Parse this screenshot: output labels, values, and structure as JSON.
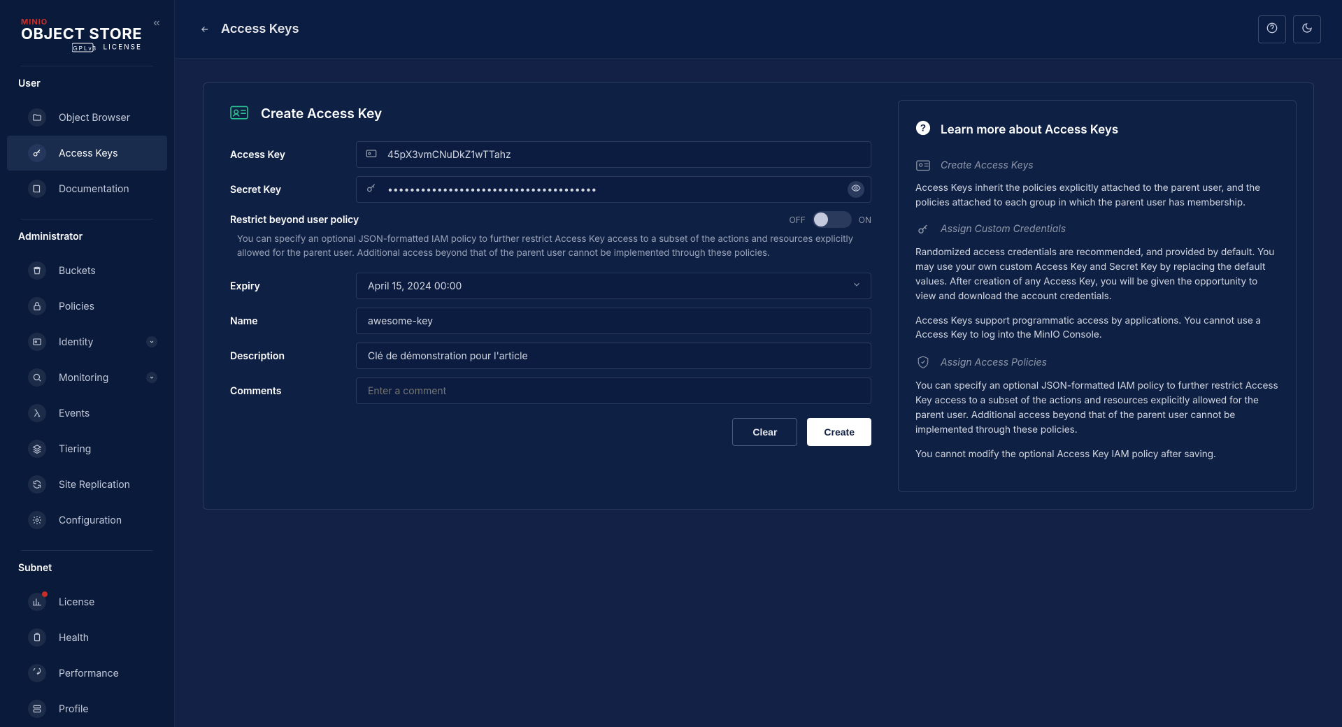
{
  "brand": {
    "minio": "MINIO",
    "product": "OBJECT STORE",
    "license": "LICENSE"
  },
  "header": {
    "title": "Access Keys"
  },
  "sidebar": {
    "sections": {
      "user": {
        "title": "User",
        "items": [
          {
            "label": "Object Browser"
          },
          {
            "label": "Access Keys"
          },
          {
            "label": "Documentation"
          }
        ]
      },
      "admin": {
        "title": "Administrator",
        "items": [
          {
            "label": "Buckets"
          },
          {
            "label": "Policies"
          },
          {
            "label": "Identity"
          },
          {
            "label": "Monitoring"
          },
          {
            "label": "Events"
          },
          {
            "label": "Tiering"
          },
          {
            "label": "Site Replication"
          },
          {
            "label": "Configuration"
          }
        ]
      },
      "subnet": {
        "title": "Subnet",
        "items": [
          {
            "label": "License"
          },
          {
            "label": "Health"
          },
          {
            "label": "Performance"
          },
          {
            "label": "Profile"
          }
        ]
      }
    }
  },
  "form": {
    "title": "Create Access Key",
    "labels": {
      "access_key": "Access Key",
      "secret_key": "Secret Key",
      "expiry": "Expiry",
      "name": "Name",
      "description": "Description",
      "comments": "Comments"
    },
    "values": {
      "access_key": "45pX3vmCNuDkZ1wTTahz",
      "secret_key": "••••••••••••••••••••••••••••••••••••••",
      "expiry": "April 15, 2024 00:00",
      "name": "awesome-key",
      "description": "Clé de démonstration pour l'article",
      "comments": ""
    },
    "placeholders": {
      "comments": "Enter a comment"
    },
    "restrict": {
      "title": "Restrict beyond user policy",
      "off": "OFF",
      "on": "ON",
      "desc": "You can specify an optional JSON-formatted IAM policy to further restrict Access Key access to a subset of the actions and resources explicitly allowed for the parent user. Additional access beyond that of the parent user cannot be implemented through these policies."
    },
    "buttons": {
      "clear": "Clear",
      "create": "Create"
    }
  },
  "info": {
    "title": "Learn more about Access Keys",
    "s1": {
      "heading": "Create Access Keys",
      "p1": "Access Keys inherit the policies explicitly attached to the parent user, and the policies attached to each group in which the parent user has membership."
    },
    "s2": {
      "heading": "Assign Custom Credentials",
      "p1": "Randomized access credentials are recommended, and provided by default. You may use your own custom Access Key and Secret Key by replacing the default values. After creation of any Access Key, you will be given the opportunity to view and download the account credentials.",
      "p2": "Access Keys support programmatic access by applications. You cannot use a Access Key to log into the MinIO Console."
    },
    "s3": {
      "heading": "Assign Access Policies",
      "p1": "You can specify an optional JSON-formatted IAM policy to further restrict Access Key access to a subset of the actions and resources explicitly allowed for the parent user. Additional access beyond that of the parent user cannot be implemented through these policies.",
      "p2": "You cannot modify the optional Access Key IAM policy after saving."
    }
  }
}
